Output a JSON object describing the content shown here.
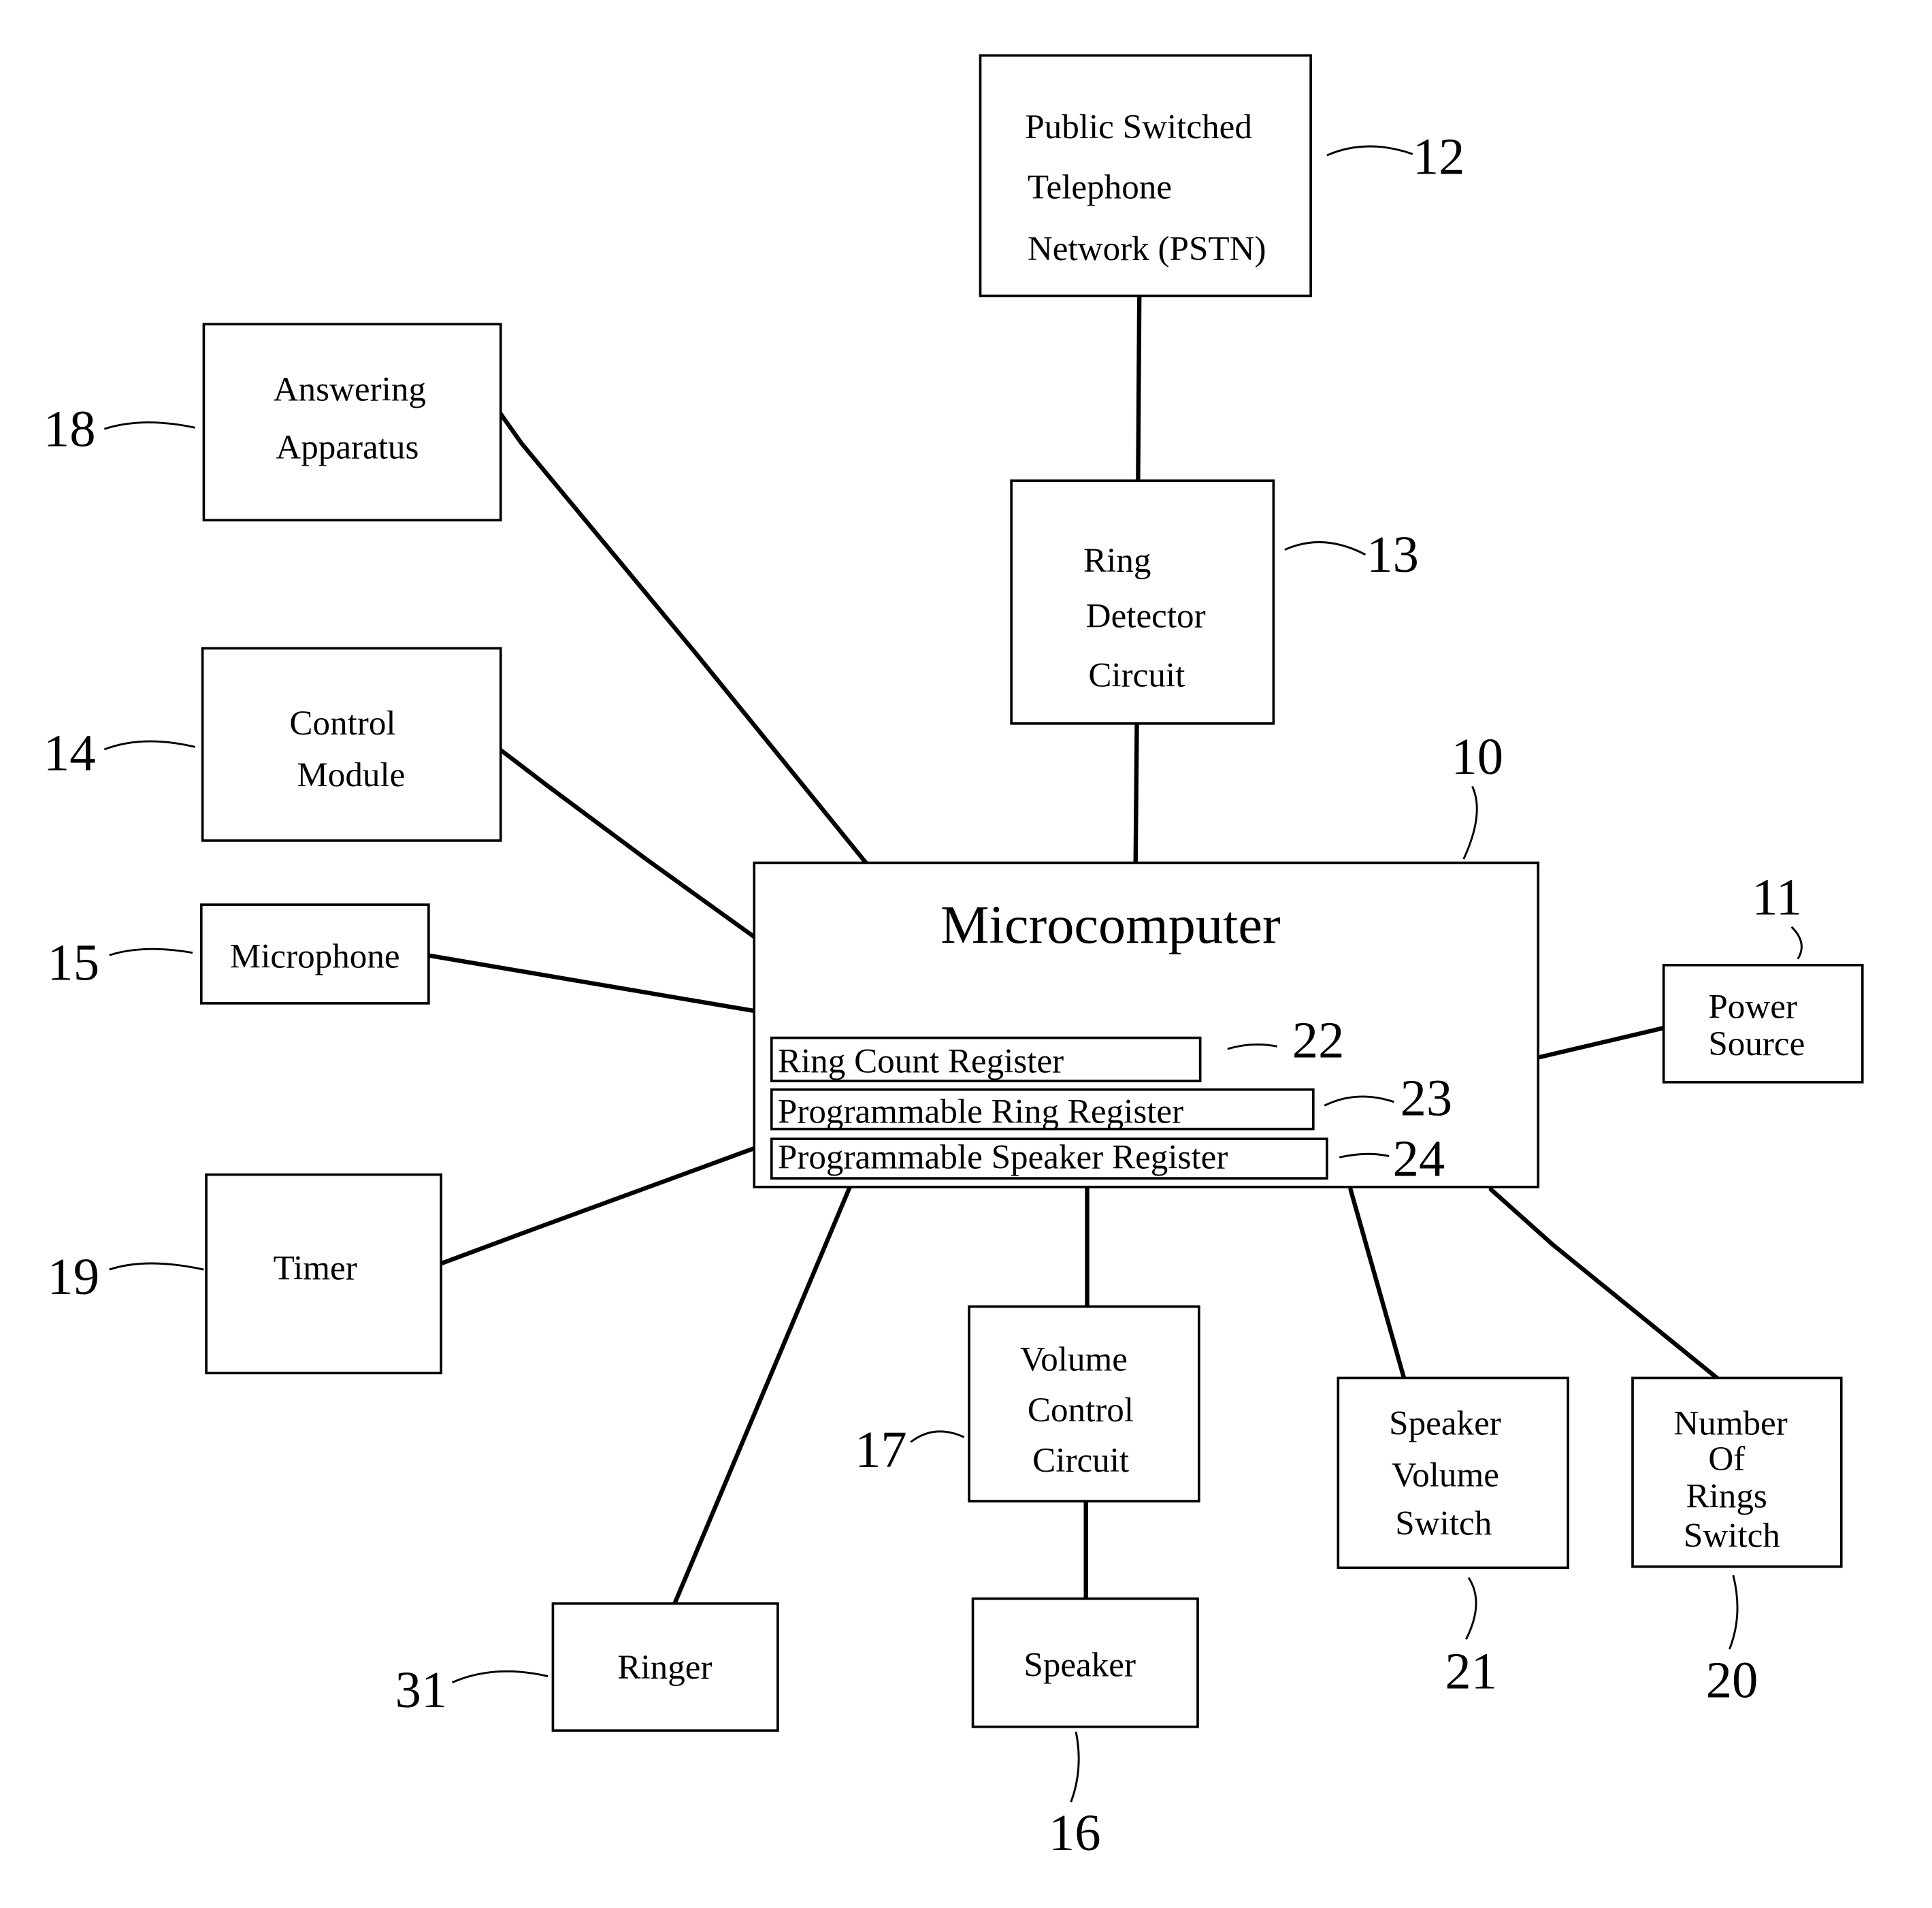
{
  "diagram": {
    "type": "block-diagram",
    "blocks": {
      "pstn": {
        "lines": [
          "Public Switched",
          "Telephone",
          "Network (PSTN)"
        ],
        "ref": "12"
      },
      "ring_detector": {
        "lines": [
          "Ring",
          "Detector",
          "Circuit"
        ],
        "ref": "13"
      },
      "answering": {
        "lines": [
          "Answering",
          "Apparatus"
        ],
        "ref": "18"
      },
      "control": {
        "lines": [
          "Control",
          "Module"
        ],
        "ref": "14"
      },
      "microphone": {
        "lines": [
          "Microphone"
        ],
        "ref": "15"
      },
      "timer": {
        "lines": [
          "Timer"
        ],
        "ref": "19"
      },
      "microcomputer": {
        "title": "Microcomputer",
        "ref": "10"
      },
      "power": {
        "lines": [
          "Power",
          "Source"
        ],
        "ref": "11"
      },
      "ringer": {
        "lines": [
          "Ringer"
        ],
        "ref": "31"
      },
      "volume_control": {
        "lines": [
          "Volume",
          "Control",
          "Circuit"
        ],
        "ref": "17"
      },
      "speaker": {
        "lines": [
          "Speaker"
        ],
        "ref": "16"
      },
      "speaker_volume_switch": {
        "lines": [
          "Speaker",
          "Volume",
          "Switch"
        ],
        "ref": "21"
      },
      "rings_switch": {
        "lines": [
          "Number",
          "Of",
          "Rings",
          "Switch"
        ],
        "ref": "20"
      }
    },
    "registers": [
      {
        "label": "Ring Count Register",
        "ref": "22"
      },
      {
        "label": "Programmable Ring Register",
        "ref": "23"
      },
      {
        "label": "Programmable Speaker Register",
        "ref": "24"
      }
    ],
    "connections": [
      [
        "pstn",
        "ring_detector"
      ],
      [
        "ring_detector",
        "microcomputer"
      ],
      [
        "answering",
        "microcomputer"
      ],
      [
        "control",
        "microcomputer"
      ],
      [
        "microphone",
        "microcomputer"
      ],
      [
        "timer",
        "microcomputer"
      ],
      [
        "power",
        "microcomputer"
      ],
      [
        "ringer",
        "microcomputer"
      ],
      [
        "volume_control",
        "microcomputer"
      ],
      [
        "volume_control",
        "speaker"
      ],
      [
        "speaker_volume_switch",
        "microcomputer"
      ],
      [
        "rings_switch",
        "microcomputer"
      ]
    ]
  }
}
